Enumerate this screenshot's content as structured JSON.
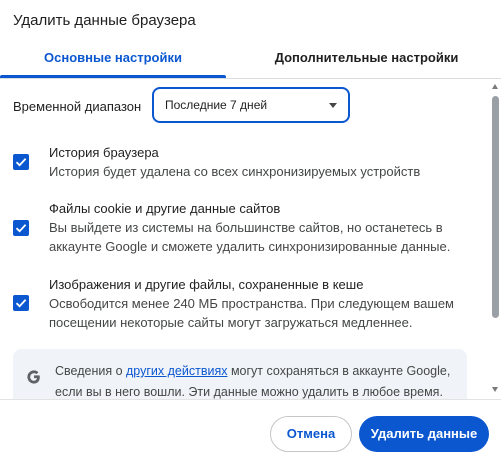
{
  "dialog": {
    "title": "Удалить данные браузера"
  },
  "tabs": [
    {
      "label": "Основные настройки",
      "active": true
    },
    {
      "label": "Дополнительные настройки",
      "active": false
    }
  ],
  "time_range": {
    "label": "Временной диапазон",
    "selected": "Последние 7 дней"
  },
  "options": [
    {
      "title": "История браузера",
      "description": "История будет удалена со всех синхронизируемых устройств",
      "checked": true
    },
    {
      "title": "Файлы cookie и другие данные сайтов",
      "description": "Вы выйдете из системы на большинстве сайтов, но останетесь в аккаунте Google и сможете удалить синхронизированные данные.",
      "checked": true
    },
    {
      "title": "Изображения и другие файлы, сохраненные в кеше",
      "description": "Освободится менее 240 МБ пространства. При следующем вашем посещении некоторые сайты могут загружаться медленнее.",
      "checked": true
    }
  ],
  "info": {
    "prefix": "Сведения о ",
    "link": "других действиях",
    "suffix": " могут сохраняться в аккаунте Google, если вы в него вошли. Эти данные можно удалить в любое время."
  },
  "buttons": {
    "cancel": "Отмена",
    "delete": "Удалить данные"
  },
  "colors": {
    "accent": "#0b57d0",
    "info_bg": "#f0f4f9"
  },
  "icons": {
    "checkbox": "checkmark-icon",
    "dropdown": "chevron-down-icon",
    "info": "google-g-icon"
  }
}
